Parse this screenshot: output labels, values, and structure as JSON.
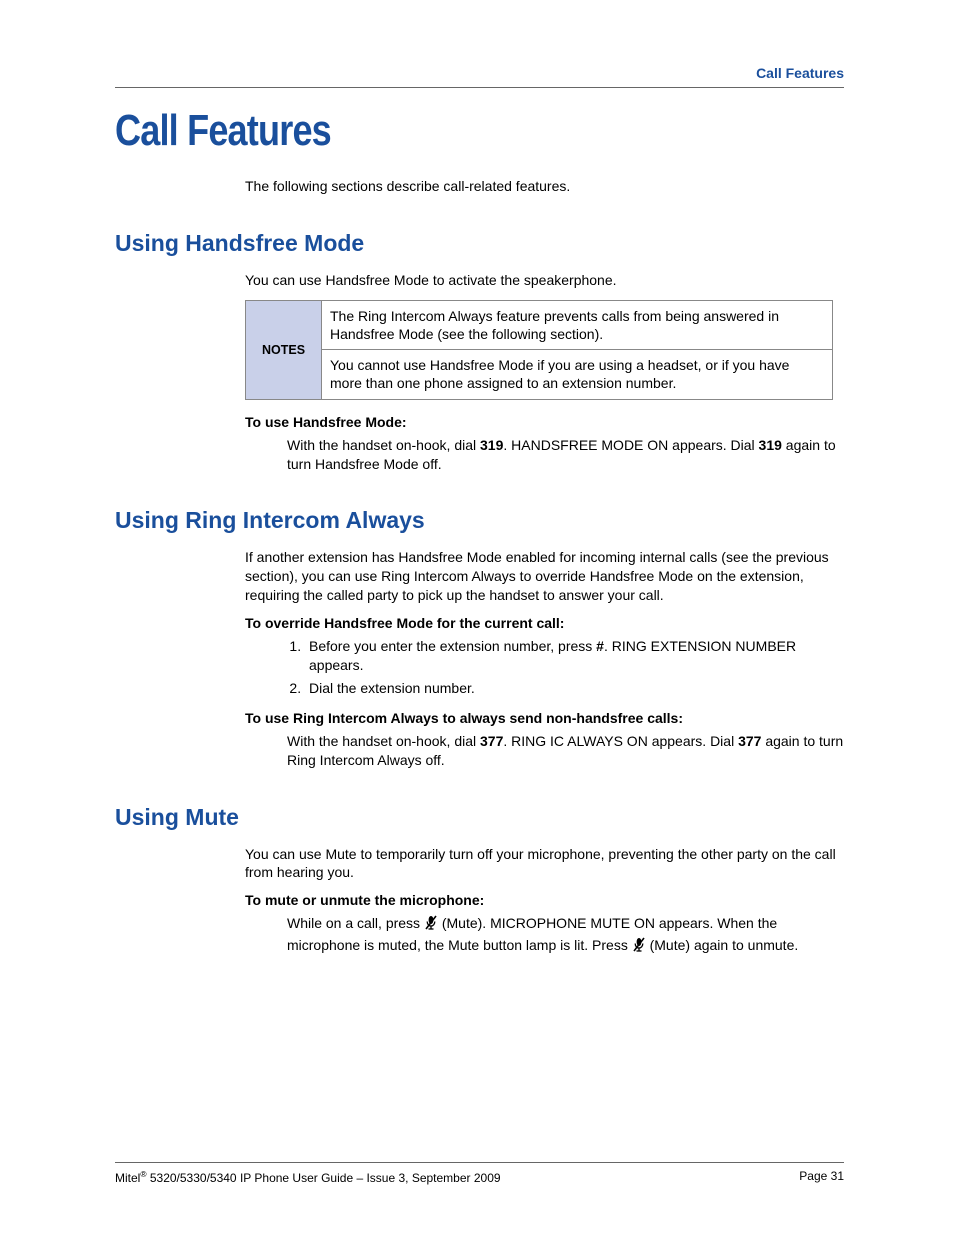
{
  "header": {
    "running_title": "Call Features"
  },
  "chapter": {
    "title": "Call Features",
    "intro": "The following sections describe call-related features."
  },
  "sections": {
    "handsfree": {
      "heading": "Using Handsfree Mode",
      "intro": "You can use Handsfree Mode to activate the speakerphone.",
      "notes_label": "NOTES",
      "note1": "The Ring Intercom Always feature prevents calls from being answered in Handsfree Mode (see the following section).",
      "note2": "You cannot use Handsfree Mode if you are using a headset, or if you have more than one phone assigned to an extension number.",
      "step_heading": "To use Handsfree Mode:",
      "step_pre": "With the handset on-hook, dial ",
      "step_code1": "319",
      "step_mid": ". HANDSFREE MODE ON appears. Dial ",
      "step_code2": "319",
      "step_post": " again to turn Handsfree Mode off."
    },
    "ring": {
      "heading": "Using Ring Intercom Always",
      "intro": "If another extension has Handsfree Mode enabled for incoming internal calls (see the previous section), you can use Ring Intercom Always to override Handsfree Mode on the extension, requiring the called party to pick up the handset to answer your call.",
      "override_heading": "To override Handsfree Mode for the current call:",
      "li1_pre": "Before you enter the extension number, press ",
      "li1_key": "#",
      "li1_post": ". RING EXTENSION NUMBER appears.",
      "li2": "Dial the extension number.",
      "always_heading": "To use Ring Intercom Always to always send non-handsfree calls:",
      "always_pre": "With the handset on-hook, dial ",
      "always_code1": "377",
      "always_mid": ". RING IC ALWAYS ON appears. Dial ",
      "always_code2": "377",
      "always_post": " again to turn Ring Intercom Always off."
    },
    "mute": {
      "heading": "Using Mute",
      "intro": "You can use Mute to temporarily turn off your microphone, preventing the other party on the call from hearing you.",
      "step_heading": "To mute or unmute the microphone:",
      "s_pre": "While on a call, press ",
      "s_icon1_label": "(Mute)",
      "s_mid": ". MICROPHONE MUTE ON appears. When the microphone is muted, the Mute button lamp is lit. Press ",
      "s_icon2_label": "(Mute)",
      "s_post": " again to unmute."
    }
  },
  "footer": {
    "left_pre": "Mitel",
    "left_sup": "®",
    "left_post": " 5320/5330/5340 IP Phone User Guide  – Issue 3, September 2009",
    "right": "Page 31"
  }
}
